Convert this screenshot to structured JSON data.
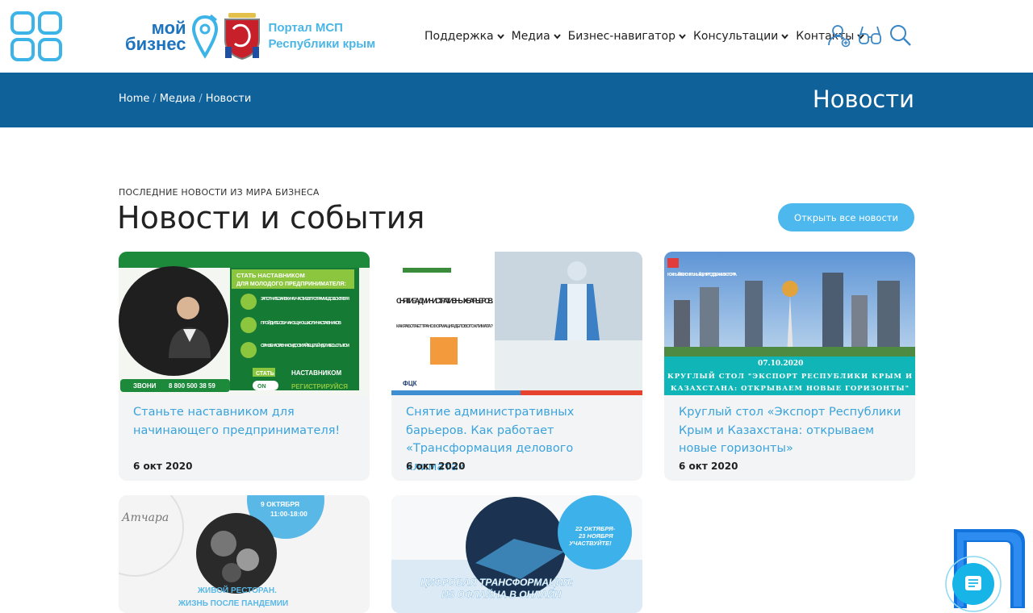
{
  "header": {
    "logo_line1": "мой",
    "logo_line2": "бизнес",
    "portal_line1": "Портал МСП",
    "portal_line2": "Республики крым",
    "nav": [
      {
        "label": "Поддержка"
      },
      {
        "label": "Медиа"
      },
      {
        "label": "Бизнес-навигатор"
      },
      {
        "label": "Консультации"
      },
      {
        "label": "Контакты"
      }
    ],
    "icons": [
      "user-icon",
      "glasses-icon",
      "search-icon"
    ]
  },
  "banner": {
    "breadcrumbs": [
      "Home",
      "Медиа",
      "Новости"
    ],
    "separator": "/",
    "title": "Новости"
  },
  "section": {
    "subtitle": "ПОСЛЕДНИЕ НОВОСТИ ИЗ МИРА БИЗНЕСА",
    "title": "Новости и события",
    "all_button": "Открыть все новости"
  },
  "cards": [
    {
      "title": "Станьте наставником для начинающего предпринимателя!",
      "date": "6 окт 2020",
      "img": {
        "banner_top": "СТАТЬ НАСТАВНИКОМ",
        "banner_sub": "ДЛЯ МОЛОДОГО ПРЕДПРИНИМАТЕЛЯ:",
        "step1": "ЗАПОЛНИТЕ ЗАЯВКУ НА УЧАСТИЕ В ПРОГРАММЕ ДО 11 ОКТЯБРЯ",
        "step2": "ПРОЙДИТЕ ОБУЧАЮЩУЮ ШКОЛУ НАСТАВНИКОВ",
        "step3": "СТАНЬТЕ НАСТАВНИКОМ, ДОСТИГАЙТЕ ЦЕЛЕЙ И ДЕЛИТЕСЬ ОПЫТОМ",
        "call_label": "ЗВОНИ",
        "phone": "8 800 500 38 59",
        "become": "СТАТЬ",
        "mentor": "НАСТАВНИКОМ",
        "register": "РЕГИСТРИРУЙСЯ",
        "on": "ON"
      }
    },
    {
      "title": "Снятие административных барьеров. Как работает «Трансформация делового климата»",
      "date": "6 окт 2020",
      "img": {
        "headline": "СНЯТИЕ АДМИНИСТРАТИВНЫХ БАРЬЕРОВ.",
        "sub": "КАК РАБОТАЕТ ТРАНСФОРМАЦИЯ ДЕЛОВОГО КЛИМАТА?",
        "logo": "ФЦК"
      }
    },
    {
      "title": "Круглый стол «Экспорт Республики Крым и Казахстана: открываем новые горизонты»",
      "date": "6 окт 2020",
      "img": {
        "corner": "ЮЖНЫЙ РЕГИОНАЛЬНЫЙ ЦЕНТР ПОДДЕРЖКИ ЭКСПОРТА",
        "date": "07.10.2020",
        "line1": "КРУГЛЫЙ СТОЛ \"ЭКСПОРТ РЕСПУБЛИКИ КРЫМ И",
        "line2": "КАЗАХСТАНА: ОТКРЫВАЕМ НОВЫЕ ГОРИЗОНТЫ\""
      }
    },
    {
      "img": {
        "date_line1": "9 ОКТЯБРЯ",
        "date_line2": "11:00-18:00",
        "title1": "ЖИВОЙ РЕСТОРАН.",
        "title2": "ЖИЗНЬ ПОСЛЕ ПАНДЕМИИ",
        "signature": "Атчара"
      }
    },
    {
      "img": {
        "date_line1": "22 ОКТЯБРЯ-",
        "date_line2": "23 НОЯБРЯ",
        "date_line3": "УЧАСТВУЙТЕ!",
        "title1": "ЦИФРОВАЯ ТРАНСФОРМАЦИЯ:",
        "title2": "ИЗ ОФЛАЙНА В ОНЛАЙН"
      }
    }
  ],
  "colors": {
    "banner": "#0f619a",
    "accent": "#4cb8ee",
    "link": "#3aa3db"
  }
}
